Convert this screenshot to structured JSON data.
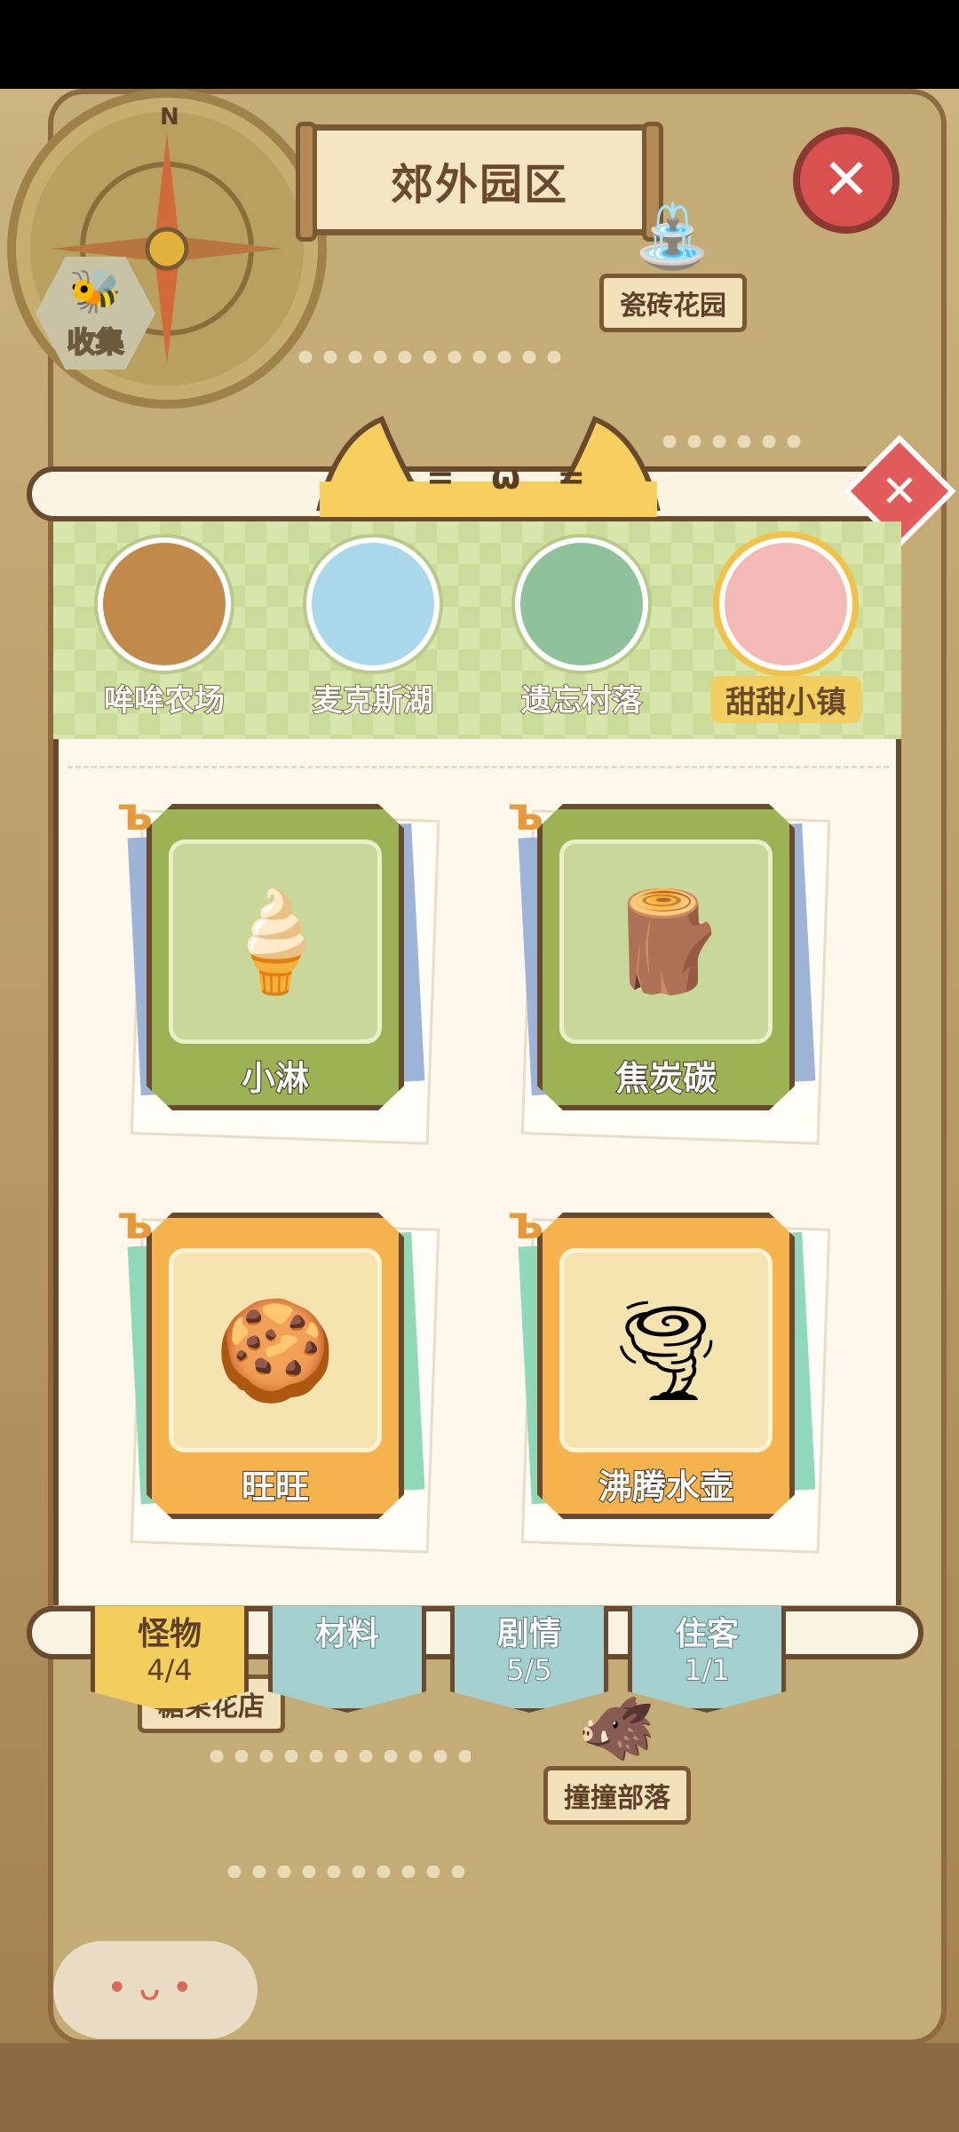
{
  "map": {
    "title": "郊外园区",
    "collect_label": "收集",
    "landmarks": [
      "瓷砖花园",
      "撞撞部落",
      "糖果花店"
    ]
  },
  "panel": {
    "cat_face": "= ω =",
    "regions": [
      {
        "name": "哞哞农场",
        "color": "#c18a4b",
        "active": false
      },
      {
        "name": "麦克斯湖",
        "color": "#a9d8ea",
        "active": false
      },
      {
        "name": "遗忘村落",
        "color": "#8fc29a",
        "active": false
      },
      {
        "name": "甜甜小镇",
        "color": "#f2b9b7",
        "active": true
      }
    ],
    "cards": [
      {
        "name": "小淋",
        "style": "green",
        "icon": "ice-cream-icon"
      },
      {
        "name": "焦炭碳",
        "style": "green",
        "icon": "charcoal-monster-icon"
      },
      {
        "name": "旺旺",
        "style": "orange",
        "icon": "gingerbread-icon"
      },
      {
        "name": "沸腾水壶",
        "style": "orange",
        "icon": "tornado-icon"
      }
    ],
    "tabs": [
      {
        "label": "怪物",
        "count": "4/4",
        "active": true
      },
      {
        "label": "材料",
        "count": "",
        "active": false
      },
      {
        "label": "剧情",
        "count": "5/5",
        "active": false
      },
      {
        "label": "住客",
        "count": "1/1",
        "active": false
      }
    ]
  },
  "colors": {
    "accent_red": "#d9514e",
    "tab_active": "#f4cf5e",
    "tab_inactive": "#a3cfcf"
  }
}
